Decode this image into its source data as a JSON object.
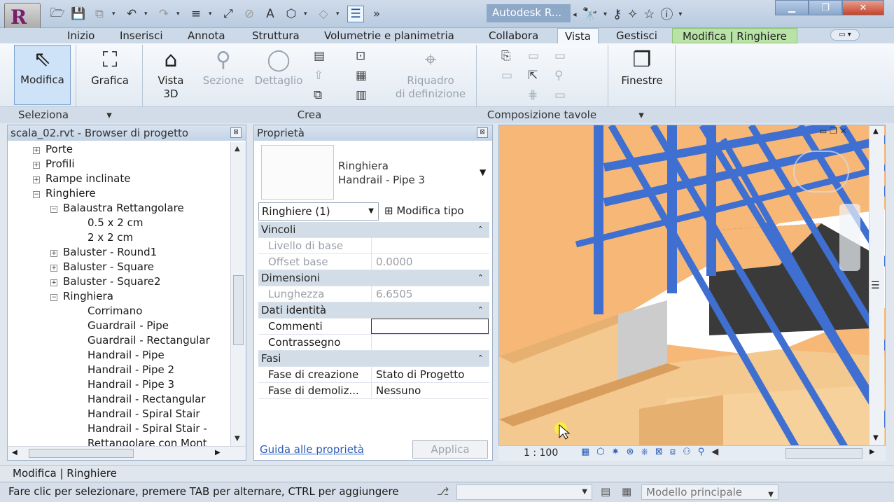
{
  "title_bar": {
    "app_title": "Autodesk R...",
    "app_menu_letter": "R"
  },
  "ribbon_tabs": [
    {
      "label": "Inizio"
    },
    {
      "label": "Inserisci"
    },
    {
      "label": "Annota"
    },
    {
      "label": "Struttura"
    },
    {
      "label": "Volumetrie e planimetria"
    },
    {
      "label": "Collabora"
    },
    {
      "label": "Vista",
      "active": true
    },
    {
      "label": "Gestisci"
    },
    {
      "label": "Modifica | Ringhiere",
      "contextual": true
    }
  ],
  "ribbon": {
    "modifica": "Modifica",
    "grafica": "Grafica",
    "vista3d_line1": "Vista",
    "vista3d_line2": "3D",
    "sezione": "Sezione",
    "dettaglio": "Dettaglio",
    "riquadro_line1": "Riquadro",
    "riquadro_line2": "di definizione",
    "finestre": "Finestre",
    "panels": {
      "seleziona": "Seleziona",
      "crea": "Crea",
      "composizione": "Composizione tavole"
    }
  },
  "project_browser": {
    "title": "scala_02.rvt - Browser di progetto",
    "nodes": [
      {
        "label": "Porte",
        "level": 1,
        "expander": "+"
      },
      {
        "label": "Profili",
        "level": 1,
        "expander": "+"
      },
      {
        "label": "Rampe inclinate",
        "level": 1,
        "expander": "+"
      },
      {
        "label": "Ringhiere",
        "level": 1,
        "expander": "−"
      },
      {
        "label": "Balaustra Rettangolare",
        "level": 2,
        "expander": "−"
      },
      {
        "label": "0.5 x 2 cm",
        "level": 3,
        "expander": ""
      },
      {
        "label": "2 x 2 cm",
        "level": 3,
        "expander": ""
      },
      {
        "label": "Baluster - Round1",
        "level": 2,
        "expander": "+"
      },
      {
        "label": "Baluster - Square",
        "level": 2,
        "expander": "+"
      },
      {
        "label": "Baluster - Square2",
        "level": 2,
        "expander": "+"
      },
      {
        "label": "Ringhiera",
        "level": 2,
        "expander": "−"
      },
      {
        "label": "Corrimano",
        "level": 3,
        "expander": ""
      },
      {
        "label": "Guardrail - Pipe",
        "level": 3,
        "expander": ""
      },
      {
        "label": "Guardrail - Rectangular",
        "level": 3,
        "expander": ""
      },
      {
        "label": "Handrail - Pipe",
        "level": 3,
        "expander": ""
      },
      {
        "label": "Handrail - Pipe 2",
        "level": 3,
        "expander": ""
      },
      {
        "label": "Handrail - Pipe 3",
        "level": 3,
        "expander": ""
      },
      {
        "label": "Handrail - Rectangular",
        "level": 3,
        "expander": ""
      },
      {
        "label": "Handrail - Spiral Stair",
        "level": 3,
        "expander": ""
      },
      {
        "label": "Handrail - Spiral Stair -",
        "level": 3,
        "expander": ""
      },
      {
        "label": "Rettangolare con Mont",
        "level": 3,
        "expander": ""
      }
    ]
  },
  "properties": {
    "title": "Proprietà",
    "type_family": "Ringhiera",
    "type_name": "Handrail - Pipe 3",
    "instance_selector": "Ringhiere (1)",
    "edit_type": "Modifica tipo",
    "sections": [
      {
        "name": "Vincoli",
        "rows": [
          {
            "key": "Livello di base",
            "value": "",
            "readonly": true
          },
          {
            "key": "Offset base",
            "value": "0.0000",
            "readonly": true
          }
        ]
      },
      {
        "name": "Dimensioni",
        "rows": [
          {
            "key": "Lunghezza",
            "value": "6.6505",
            "readonly": true
          }
        ]
      },
      {
        "name": "Dati identità",
        "rows": [
          {
            "key": "Commenti",
            "value": "",
            "readonly": false,
            "editing": true
          },
          {
            "key": "Contrassegno",
            "value": "",
            "readonly": false
          }
        ]
      },
      {
        "name": "Fasi",
        "rows": [
          {
            "key": "Fase di creazione",
            "value": "Stato di Progetto",
            "readonly": false
          },
          {
            "key": "Fase di demoliz...",
            "value": "Nessuno",
            "readonly": false
          }
        ]
      }
    ],
    "help_link": "Guida alle proprietà",
    "apply": "Applica"
  },
  "viewport": {
    "scale": "1 : 100"
  },
  "status": {
    "context": "Modifica | Ringhiere",
    "hint": "Fare clic per selezionare, premere TAB per alternare, CTRL per aggiungere",
    "model": "Modello principale"
  },
  "colors": {
    "railing": "#3f6fd1",
    "wood": "#f3c98f",
    "wall": "#f7b877",
    "contextual_tab": "#b9e3a6"
  }
}
